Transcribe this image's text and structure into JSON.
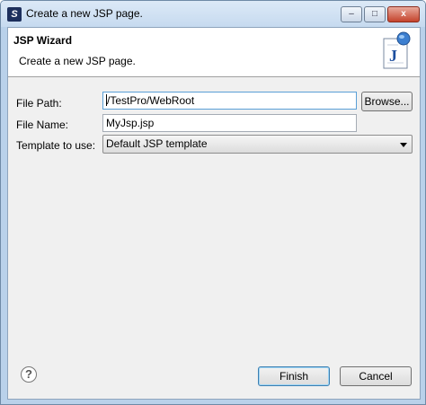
{
  "window": {
    "title": "Create a new JSP page.",
    "minimize_glyph": "–",
    "maximize_glyph": "□",
    "close_glyph": "x"
  },
  "banner": {
    "title": "JSP Wizard",
    "description": "Create a new JSP page.",
    "icon_letter": "J"
  },
  "form": {
    "file_path_label": "File Path:",
    "file_path_value": "/TestPro/WebRoot",
    "browse_label": "Browse...",
    "file_name_label": "File Name:",
    "file_name_value": "MyJsp.jsp",
    "template_label": "Template to use:",
    "template_selected": "Default JSP template"
  },
  "footer": {
    "help_glyph": "?",
    "finish_label": "Finish",
    "cancel_label": "Cancel"
  },
  "colors": {
    "titlebar": "#c6daef",
    "client_bg": "#f0f0f0",
    "close_button": "#c4432c"
  }
}
